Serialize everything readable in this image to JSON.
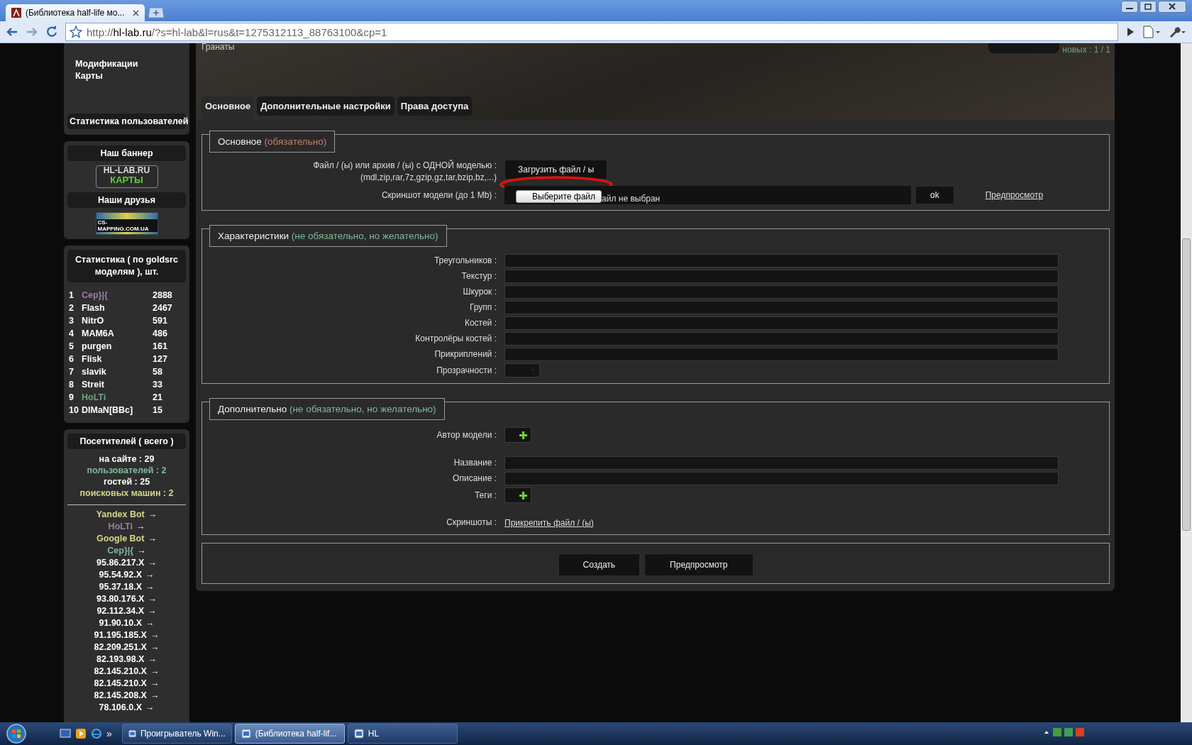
{
  "browser": {
    "tab_title": "(Библиотека half-life мо...",
    "url": {
      "scheme": "http://",
      "host": "hl-lab.ru",
      "path": "/?s=hl-lab&l=rus&t=1275312113_88763100&cp=1"
    }
  },
  "sidebar": {
    "nav_items": [
      "Модификации",
      "Карты"
    ],
    "user_stats_button": "Статистика пользователей",
    "banner_heading": "Наш баннер",
    "banner_lines": [
      "HL-LAB.RU",
      "КАРТЫ"
    ],
    "friends_heading": "Наши друзья",
    "friends_banner": "CS-MAPPING.COM.UA",
    "stats_heading": "Статистика ( по goldsrc моделям ), шт.",
    "stats_rows": [
      {
        "rank": "1",
        "name": "Сер}|{",
        "count": "2888",
        "color": "#9a7fa8"
      },
      {
        "rank": "2",
        "name": "Flash",
        "count": "2467",
        "color": "#ffffff"
      },
      {
        "rank": "3",
        "name": "NitrO",
        "count": "591",
        "color": "#ffffff"
      },
      {
        "rank": "4",
        "name": "MAM6A",
        "count": "486",
        "color": "#ffffff"
      },
      {
        "rank": "5",
        "name": "purgen",
        "count": "161",
        "color": "#ffffff"
      },
      {
        "rank": "6",
        "name": "Flisk",
        "count": "127",
        "color": "#ffffff"
      },
      {
        "rank": "7",
        "name": "slavik",
        "count": "58",
        "color": "#ffffff"
      },
      {
        "rank": "8",
        "name": "Streit",
        "count": "33",
        "color": "#ffffff"
      },
      {
        "rank": "9",
        "name": "HoLTi",
        "count": "21",
        "color": "#6fa07f"
      },
      {
        "rank": "10",
        "name": "DIMaN[BBc]",
        "count": "15",
        "color": "#ffffff"
      }
    ],
    "visitors_heading": "Посетителей ( всего )",
    "visitor_counts": [
      {
        "text": "на сайте : 29",
        "color": "#ffffff"
      },
      {
        "text": "пользователей : 2",
        "color": "#7fb89a"
      },
      {
        "text": "гостей : 25",
        "color": "#ffffff"
      },
      {
        "text": "поисковых машин : 2",
        "color": "#d6d68a"
      }
    ],
    "online": [
      {
        "name": "Yandex Bot",
        "arrow": "→",
        "color": "#d6d68a"
      },
      {
        "name": "HoLTi",
        "arrow": "→",
        "color": "#9a7fa8"
      },
      {
        "name": "Google Bot",
        "arrow": "→",
        "color": "#d6d68a"
      },
      {
        "name": "Сер}|{",
        "arrow": "→",
        "color": "#7fb89a"
      },
      {
        "name": "95.86.217.X",
        "arrow": "→",
        "color": "#ffffff"
      },
      {
        "name": "95.54.92.X",
        "arrow": "→",
        "color": "#ffffff"
      },
      {
        "name": "95.37.18.X",
        "arrow": "→",
        "color": "#ffffff"
      },
      {
        "name": "93.80.176.X",
        "arrow": "→",
        "color": "#ffffff"
      },
      {
        "name": "92.112.34.X",
        "arrow": "→",
        "color": "#ffffff"
      },
      {
        "name": "91.90.10.X",
        "arrow": "→",
        "color": "#ffffff"
      },
      {
        "name": "91.195.185.X",
        "arrow": "→",
        "color": "#ffffff"
      },
      {
        "name": "82.209.251.X",
        "arrow": "→",
        "color": "#ffffff"
      },
      {
        "name": "82.193.98.X",
        "arrow": "→",
        "color": "#ffffff"
      },
      {
        "name": "82.145.210.X",
        "arrow": "→",
        "color": "#ffffff"
      },
      {
        "name": "82.145.210.X",
        "arrow": "→",
        "color": "#ffffff"
      },
      {
        "name": "82.145.208.X",
        "arrow": "→",
        "color": "#ffffff"
      },
      {
        "name": "78.106.0.X",
        "arrow": "→",
        "color": "#ffffff"
      }
    ]
  },
  "main": {
    "header_text": "Гранаты",
    "new_count": "новых : 1 / 1",
    "tabs": [
      {
        "label": "Основное",
        "selected": true
      },
      {
        "label": "Дополнительные настройки",
        "selected": false
      },
      {
        "label": "Права доступа",
        "selected": false
      }
    ],
    "sections": [
      {
        "title": "Основное",
        "note": "(обязательно)",
        "color": "#c0806a",
        "rows": [
          {
            "kind": "upload",
            "label": "Файл / (ы) или архив / (ы) с ОДНОЙ моделью :",
            "hint": "(mdl,zip,rar,7z,gzip,gz,tar,bzip,bz,...)",
            "button": "Загрузить файл / ы"
          },
          {
            "kind": "file",
            "label": "Скриншот модели (до 1 Mb) :",
            "file_button": "Выберите файл",
            "file_status": "айл не выбран",
            "ok_button": "ok",
            "link": "Предпросмотр"
          }
        ]
      },
      {
        "title": "Характеристики",
        "note": "(не обязательно, но желательно)",
        "color": "#7fb89a",
        "rows": [
          {
            "kind": "text",
            "label": "Треугольников :"
          },
          {
            "kind": "text",
            "label": "Текстур :"
          },
          {
            "kind": "text",
            "label": "Шкурок :"
          },
          {
            "kind": "text",
            "label": "Групп :"
          },
          {
            "kind": "text",
            "label": "Костей :"
          },
          {
            "kind": "text",
            "label": "Контролёры костей :"
          },
          {
            "kind": "text",
            "label": "Прикриплений :"
          },
          {
            "kind": "select",
            "label": "Прозрачности :"
          }
        ]
      },
      {
        "title": "Дополнительно",
        "note": "(не обязательно, но желательно)",
        "color": "#7fb89a",
        "rows": [
          {
            "kind": "add",
            "label": "Автор модели :"
          },
          {
            "kind": "text",
            "label": "Название :"
          },
          {
            "kind": "text",
            "label": "Описание :"
          },
          {
            "kind": "add",
            "label": "Теги :"
          },
          {
            "kind": "link",
            "label": "Скриншоты :",
            "link": "Прикрепить файл / (ы)"
          }
        ]
      }
    ],
    "buttons": [
      "Создать",
      "Предпросмотр"
    ]
  },
  "taskbar": {
    "quick_more": "»",
    "items": [
      {
        "label": "Проигрыватель Win...",
        "selected": false
      },
      {
        "label": "(Библиотека half-lif...",
        "selected": true
      },
      {
        "label": "HL",
        "selected": false
      }
    ]
  }
}
